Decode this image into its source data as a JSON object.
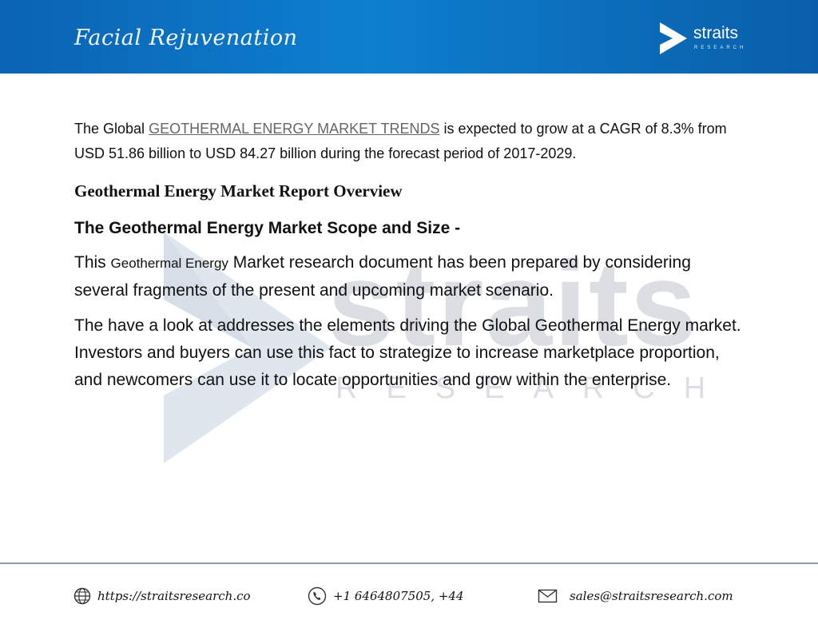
{
  "header": {
    "title": "Facial Rejuvenation",
    "brand_name": "straits",
    "brand_sub": "RESEARCH",
    "background_color": "#0b6fc2"
  },
  "watermark": {
    "word": "straits",
    "sub": "RESEARCH"
  },
  "article": {
    "intro_prefix": "The Global ",
    "intro_link": "GEOTHERMAL ENERGY MARKET TRENDS",
    "intro_suffix": " is expected to grow at a CAGR of 8.3% from USD 51.86 billion to USD 84.27 billion during the forecast period of 2017-2029.",
    "overview_heading": "Geothermal Energy Market Report Overview",
    "scope_heading": "The Geothermal Energy Market Scope and Size -",
    "para1_prefix": "This ",
    "para1_small": "Geothermal Energy",
    "para1_suffix": " Market research document has been prepared by considering several fragments of the present and upcoming market scenario.",
    "para2": "The have a look at addresses the elements driving the Global Geothermal Energy market. Investors and buyers can use this fact to strategize to increase marketplace proportion, and newcomers can use it to locate opportunities and grow within the enterprise."
  },
  "footer": {
    "website": "https://straitsresearch.co",
    "website_icon": "globe-icon",
    "phone": "+1 6464807505, +44",
    "phone_icon": "phone-icon",
    "email": "sales@straitsresearch.com",
    "email_icon": "mail-icon"
  }
}
